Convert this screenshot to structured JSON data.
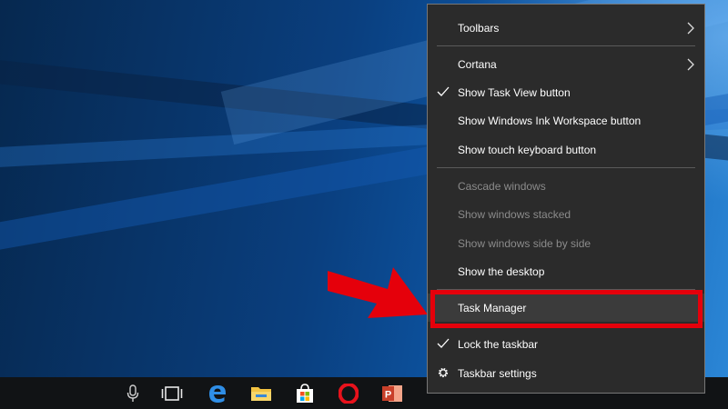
{
  "menu": {
    "items": [
      {
        "label": "Toolbars",
        "checked": false,
        "disabled": false,
        "submenu": true
      },
      {
        "label": "Cortana",
        "checked": false,
        "disabled": false,
        "submenu": true
      },
      {
        "label": "Show Task View button",
        "checked": true,
        "disabled": false,
        "submenu": false
      },
      {
        "label": "Show Windows Ink Workspace button",
        "checked": false,
        "disabled": false,
        "submenu": false
      },
      {
        "label": "Show touch keyboard button",
        "checked": false,
        "disabled": false,
        "submenu": false
      },
      {
        "label": "Cascade windows",
        "checked": false,
        "disabled": true,
        "submenu": false
      },
      {
        "label": "Show windows stacked",
        "checked": false,
        "disabled": true,
        "submenu": false
      },
      {
        "label": "Show windows side by side",
        "checked": false,
        "disabled": true,
        "submenu": false
      },
      {
        "label": "Show the desktop",
        "checked": false,
        "disabled": false,
        "submenu": false
      },
      {
        "label": "Task Manager",
        "checked": false,
        "disabled": false,
        "submenu": false,
        "highlighted": true
      },
      {
        "label": "Lock the taskbar",
        "checked": true,
        "disabled": false,
        "submenu": false
      },
      {
        "label": "Taskbar settings",
        "checked": false,
        "disabled": false,
        "submenu": false,
        "icon": "gear-icon"
      }
    ]
  },
  "taskbar": {
    "icons": [
      "microphone-icon",
      "task-view-icon",
      "edge-icon",
      "file-explorer-icon",
      "store-icon",
      "opera-icon",
      "powerpoint-icon"
    ]
  },
  "annotation": {
    "arrow": "red-arrow-icon",
    "highlight_color": "#e5000b"
  },
  "colors": {
    "menu_bg": "#2b2b2b",
    "menu_text": "#ffffff",
    "disabled_text": "#8b8b8b",
    "taskbar_bg": "#111315"
  }
}
